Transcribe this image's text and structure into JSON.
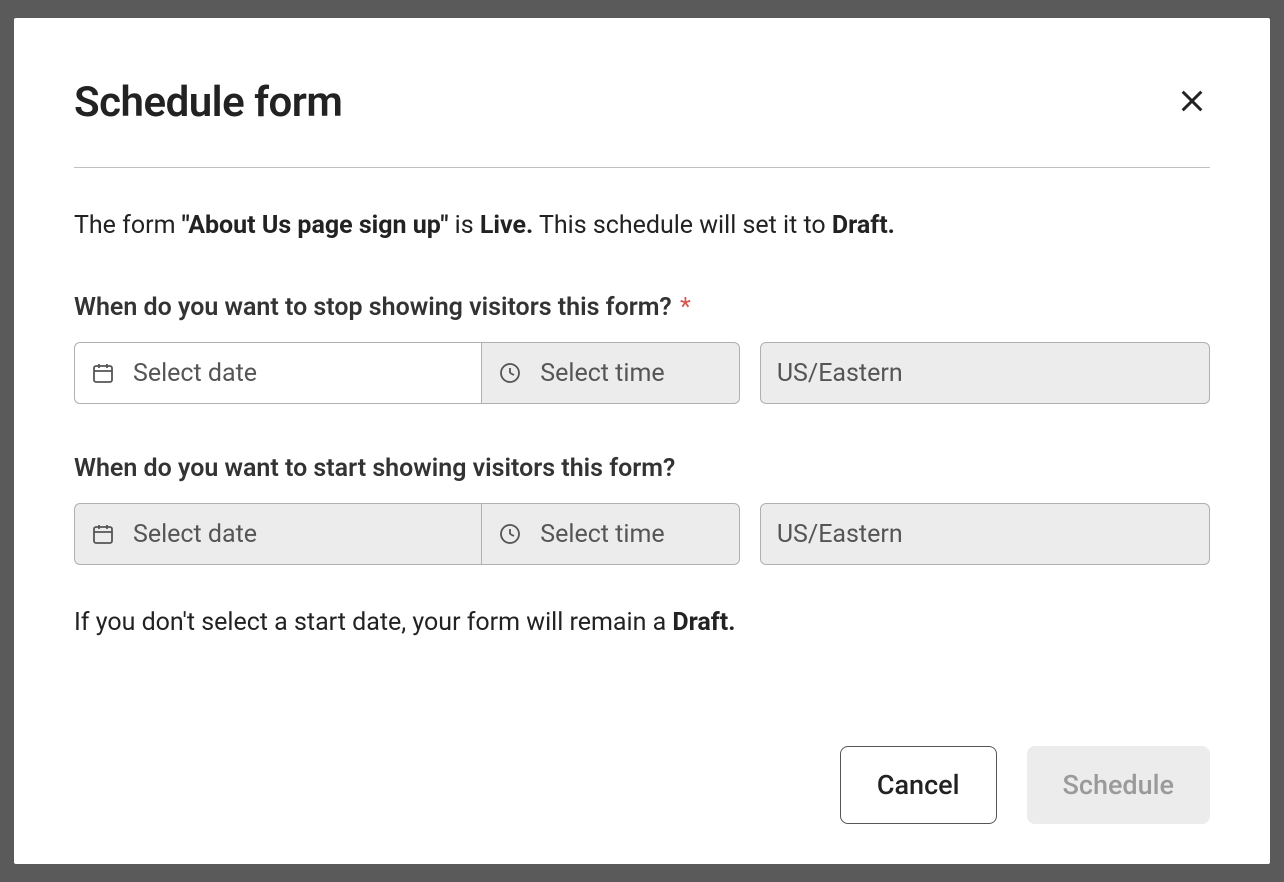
{
  "modal": {
    "title": "Schedule form",
    "description": {
      "prefix": "The form ",
      "form_name": "\"About Us page sign up\"",
      "mid1": " is ",
      "status": "Live.",
      "mid2": " This schedule will set it to ",
      "target_status": "Draft.",
      "suffix": ""
    },
    "stop_section": {
      "label": "When do you want to stop showing visitors this form?",
      "required": "*",
      "date_placeholder": "Select date",
      "time_placeholder": "Select time",
      "timezone": "US/Eastern"
    },
    "start_section": {
      "label": "When do you want to start showing visitors this form?",
      "date_placeholder": "Select date",
      "time_placeholder": "Select time",
      "timezone": "US/Eastern"
    },
    "helper": {
      "prefix": "If you don't select a start date, your form will remain a ",
      "status": "Draft.",
      "suffix": ""
    },
    "footer": {
      "cancel": "Cancel",
      "schedule": "Schedule"
    }
  }
}
